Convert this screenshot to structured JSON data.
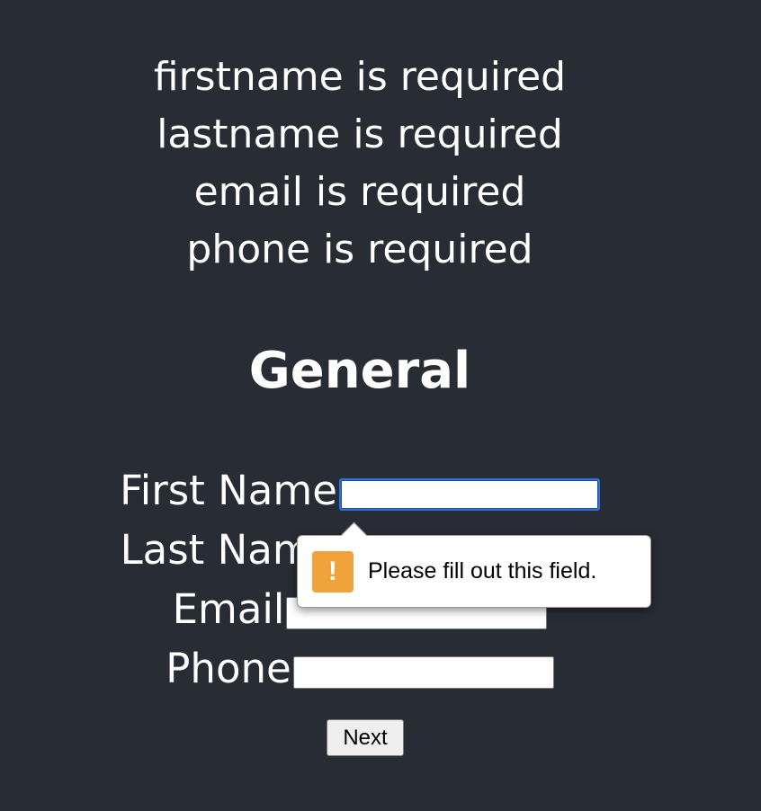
{
  "errors": [
    "firstname is required",
    "lastname is required",
    "email is required",
    "phone is required"
  ],
  "form": {
    "title": "General",
    "fields": [
      {
        "label": "First Name",
        "value": ""
      },
      {
        "label": "Last Name",
        "value": ""
      },
      {
        "label": "Email",
        "value": ""
      },
      {
        "label": "Phone",
        "value": ""
      }
    ],
    "next_label": "Next"
  },
  "validation_tooltip": {
    "icon": "warning-icon",
    "icon_color": "#f0a33a",
    "message": "Please fill out this field."
  },
  "colors": {
    "background": "#282c34",
    "focus_border": "#2e6fd8"
  }
}
